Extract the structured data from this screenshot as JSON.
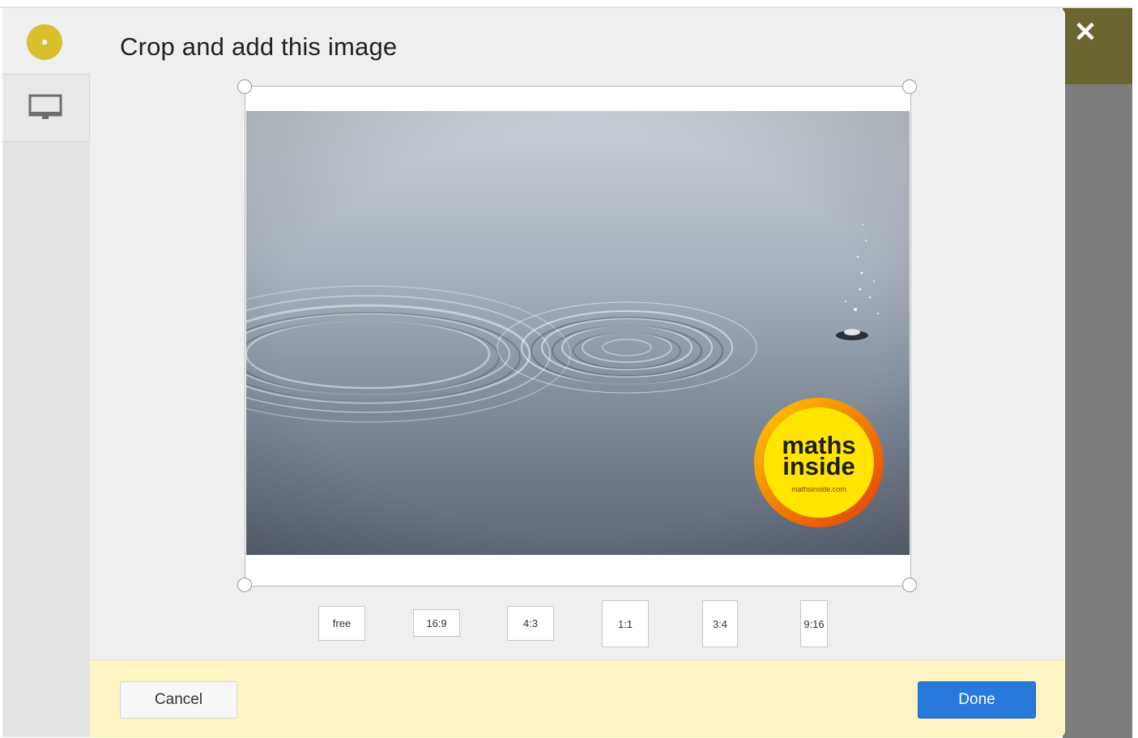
{
  "dialog": {
    "title": "Crop and add this image",
    "close_icon": "close-icon"
  },
  "sidebar": {
    "logo_icon": "app-logo-icon",
    "items": [
      {
        "icon": "monitor-icon",
        "selected": true
      }
    ]
  },
  "image": {
    "logo": {
      "line1": "maths",
      "line2": "inside",
      "url": "mathsinside.com"
    }
  },
  "aspect_ratios": [
    "free",
    "16:9",
    "4:3",
    "1:1",
    "3:4",
    "9:16"
  ],
  "footer": {
    "cancel_label": "Cancel",
    "done_label": "Done"
  },
  "colors": {
    "accent": "#2879dc",
    "footer_bg": "#fdf4c4",
    "logo_dot": "#d9be2d"
  }
}
